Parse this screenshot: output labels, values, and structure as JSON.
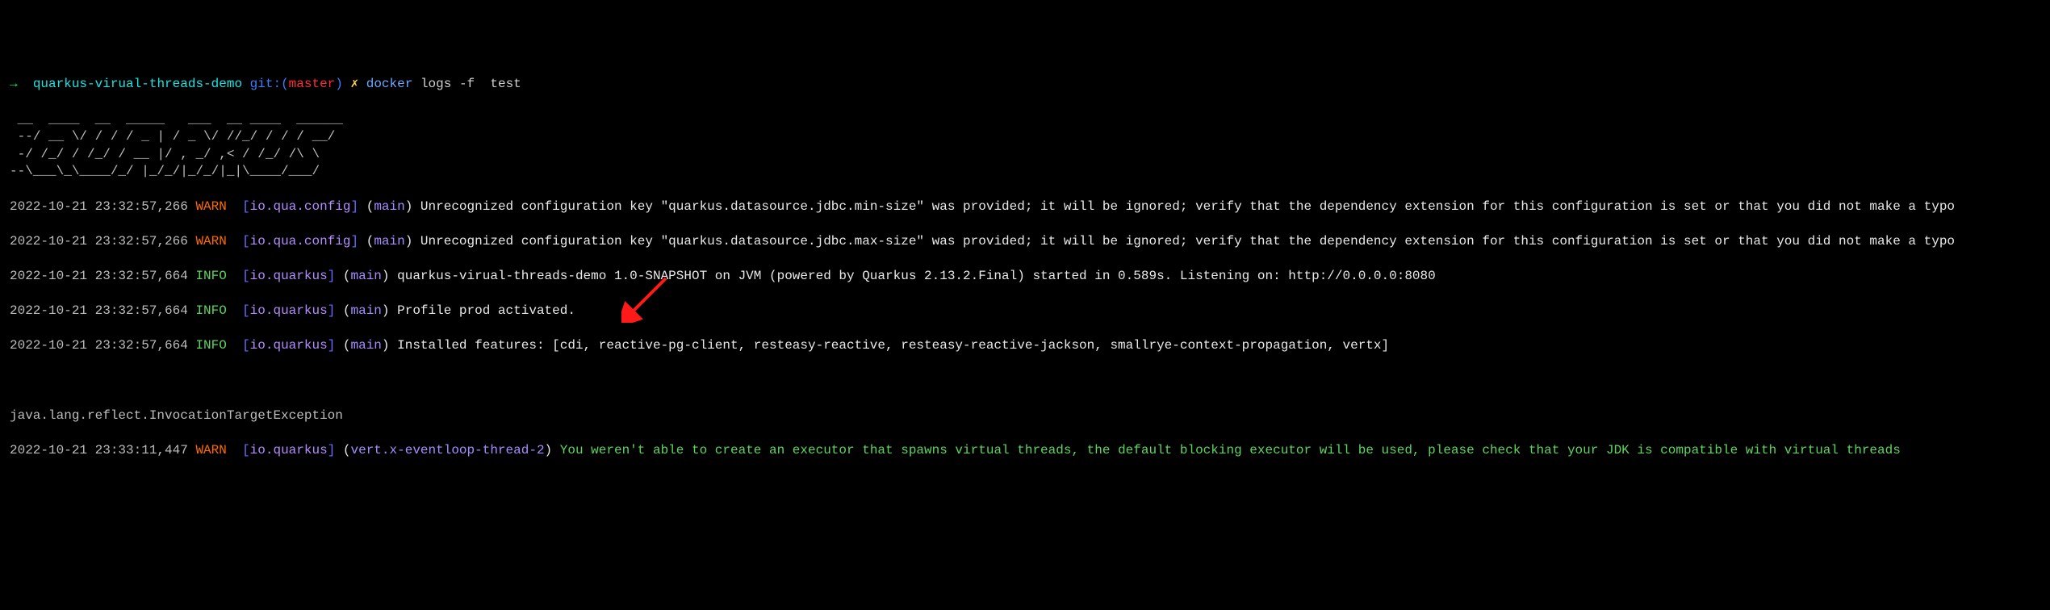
{
  "prompt": {
    "arrow": "→  ",
    "dir": "quarkus-virual-threads-demo",
    "git_label": " git:(",
    "branch": "master",
    "git_close": ") ",
    "dirty": "✗",
    "cmd_prefix": " docker",
    "cmd_rest": " logs -f  test"
  },
  "ascii": " __  ____  __  _____   ___  __ ____  ______\n --/ __ \\/ / / / _ | / _ \\/ //_/ / / / __/\n -/ /_/ / /_/ / __ |/ , _/ ,< / /_/ /\\ \\\n--\\___\\_\\____/_/ |_/_/|_/_/|_|\\____/___/",
  "logs": [
    {
      "ts": "2022-10-21 23:32:57,266",
      "level": "WARN",
      "source": "io.qua.config",
      "thread": "main",
      "msg": "Unrecognized configuration key \"quarkus.datasource.jdbc.min-size\" was provided; it will be ignored; verify that the dependency extension for this configuration is set or that you did not make a typo"
    },
    {
      "ts": "2022-10-21 23:32:57,266",
      "level": "WARN",
      "source": "io.qua.config",
      "thread": "main",
      "msg": "Unrecognized configuration key \"quarkus.datasource.jdbc.max-size\" was provided; it will be ignored; verify that the dependency extension for this configuration is set or that you did not make a typo"
    },
    {
      "ts": "2022-10-21 23:32:57,664",
      "level": "INFO",
      "source": "io.quarkus",
      "thread": "main",
      "msg": "quarkus-virual-threads-demo 1.0-SNAPSHOT on JVM (powered by Quarkus 2.13.2.Final) started in 0.589s. Listening on: http://0.0.0.0:8080"
    },
    {
      "ts": "2022-10-21 23:32:57,664",
      "level": "INFO",
      "source": "io.quarkus",
      "thread": "main",
      "msg": "Profile prod activated."
    },
    {
      "ts": "2022-10-21 23:32:57,664",
      "level": "INFO",
      "source": "io.quarkus",
      "thread": "main",
      "msg": "Installed features: [cdi, reactive-pg-client, resteasy-reactive, resteasy-reactive-jackson, smallrye-context-propagation, vertx]"
    }
  ],
  "gap": "\n",
  "exception": "java.lang.reflect.InvocationTargetException",
  "vt_warn": {
    "ts": "2022-10-21 23:33:11,447",
    "level": "WARN",
    "source": "io.quarkus",
    "thread": "vert.x-eventloop-thread-2",
    "msg_highlight": "You weren't able to create an executor that spawns virtual threads, the default blocking executor will be used, please check that your JDK is compatible with virtual threads"
  }
}
